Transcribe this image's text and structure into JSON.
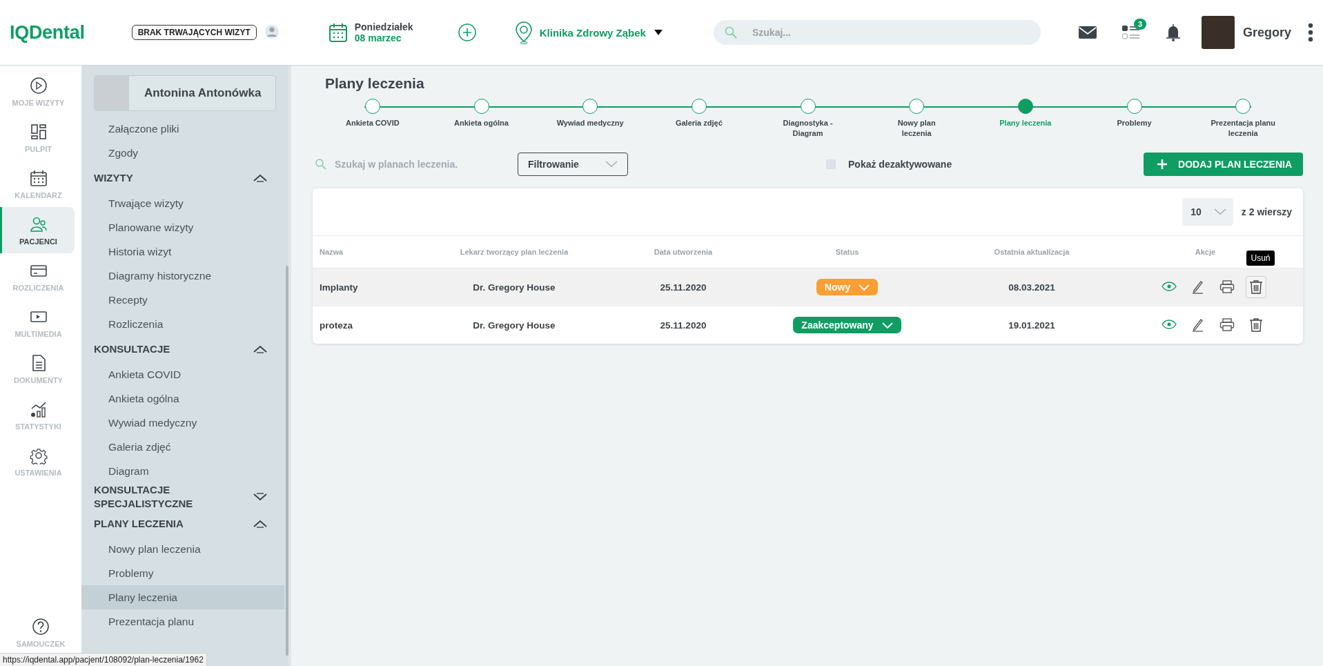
{
  "topbar": {
    "logo": "IQDental",
    "visit_status": "BRAK TRWAJĄCYCH WIZYT",
    "date": {
      "weekday": "Poniedziałek",
      "day": "08 marzec"
    },
    "clinic": "Klinika Zdrowy Ząbek",
    "search": {
      "placeholder": "Szukaj..."
    },
    "tasks_badge": "3",
    "user": "Gregory"
  },
  "rail": {
    "items": [
      {
        "label": "MOJE WIZYTY",
        "selected": false
      },
      {
        "label": "PULPIT",
        "selected": false
      },
      {
        "label": "KALENDARZ",
        "selected": false
      },
      {
        "label": "PACJENCI",
        "selected": true
      },
      {
        "label": "ROZLICZENIA",
        "selected": false
      },
      {
        "label": "MULTIMEDIA",
        "selected": false
      },
      {
        "label": "DOKUMENTY",
        "selected": false
      },
      {
        "label": "STATYSTYKI",
        "selected": false
      },
      {
        "label": "USTAWIENIA",
        "selected": false
      }
    ],
    "help": "SAMOUCZEK"
  },
  "patient": {
    "name": "Antonina Antonówka",
    "top_items": [
      {
        "label": "Załączone pliki",
        "selected": false
      },
      {
        "label": "Zgody",
        "selected": false
      }
    ],
    "sections": [
      {
        "title": "WIZYTY",
        "expanded": true,
        "items": [
          {
            "label": "Trwające wizyty",
            "selected": false
          },
          {
            "label": "Planowane wizyty",
            "selected": false
          },
          {
            "label": "Historia wizyt",
            "selected": false
          },
          {
            "label": "Diagramy historyczne",
            "selected": false
          },
          {
            "label": "Recepty",
            "selected": false
          },
          {
            "label": "Rozliczenia",
            "selected": false
          }
        ]
      },
      {
        "title": "KONSULTACJE",
        "expanded": true,
        "items": [
          {
            "label": "Ankieta COVID",
            "selected": false
          },
          {
            "label": "Ankieta ogólna",
            "selected": false
          },
          {
            "label": "Wywiad medyczny",
            "selected": false
          },
          {
            "label": "Galeria zdjęć",
            "selected": false
          },
          {
            "label": "Diagram",
            "selected": false
          }
        ]
      },
      {
        "title": "KONSULTACJE SPECJALISTYCZNE",
        "expanded": false
      },
      {
        "title": "PLANY LECZENIA",
        "expanded": true,
        "items": [
          {
            "label": "Nowy plan leczenia",
            "selected": false
          },
          {
            "label": "Problemy",
            "selected": false
          },
          {
            "label": "Plany leczenia",
            "selected": true
          },
          {
            "label": "Prezentacja planu",
            "selected": false
          }
        ]
      }
    ]
  },
  "main": {
    "title": "Plany leczenia",
    "steps": [
      {
        "label": "Ankieta COVID",
        "selected": false
      },
      {
        "label": "Ankieta ogólna",
        "selected": false
      },
      {
        "label": "Wywiad medyczny",
        "selected": false
      },
      {
        "label": "Galeria zdjęć",
        "selected": false
      },
      {
        "label": "Diagnostyka - Diagram",
        "selected": false
      },
      {
        "label": "Nowy plan leczenia",
        "selected": false
      },
      {
        "label": "Plany leczenia",
        "selected": true
      },
      {
        "label": "Problemy",
        "selected": false
      },
      {
        "label": "Prezentacja planu leczenia",
        "selected": false
      }
    ],
    "search": {
      "placeholder": "Szukaj w planach leczenia."
    },
    "filter": "Filtrowanie",
    "show_inactive": {
      "label": "Pokaż dezaktywowane",
      "checked": false
    },
    "add_button": "DODAJ PLAN LECZENIA",
    "table": {
      "page_size": "10",
      "rows_info": "z 2 wierszy",
      "columns": [
        "Nazwa",
        "Lekarz tworzący plan leczenia",
        "Data utworzenia",
        "Status",
        "Ostatnia aktualizacja",
        "Akcje"
      ],
      "tooltip": "Usuń",
      "rows": [
        {
          "name": "Implanty",
          "doctor": "Dr. Gregory House",
          "created": "25.11.2020",
          "status": {
            "label": "Nowy",
            "color": "#fb9e33"
          },
          "updated": "08.03.2021",
          "hovered": true
        },
        {
          "name": "proteza",
          "doctor": "Dr. Gregory House",
          "created": "25.11.2020",
          "status": {
            "label": "Zaakceptowany",
            "color": "#0f9d63"
          },
          "updated": "19.01.2021",
          "hovered": false
        }
      ]
    }
  },
  "status_url": "https://iqdental.app/pacjent/108092/plan-leczenia/1962"
}
